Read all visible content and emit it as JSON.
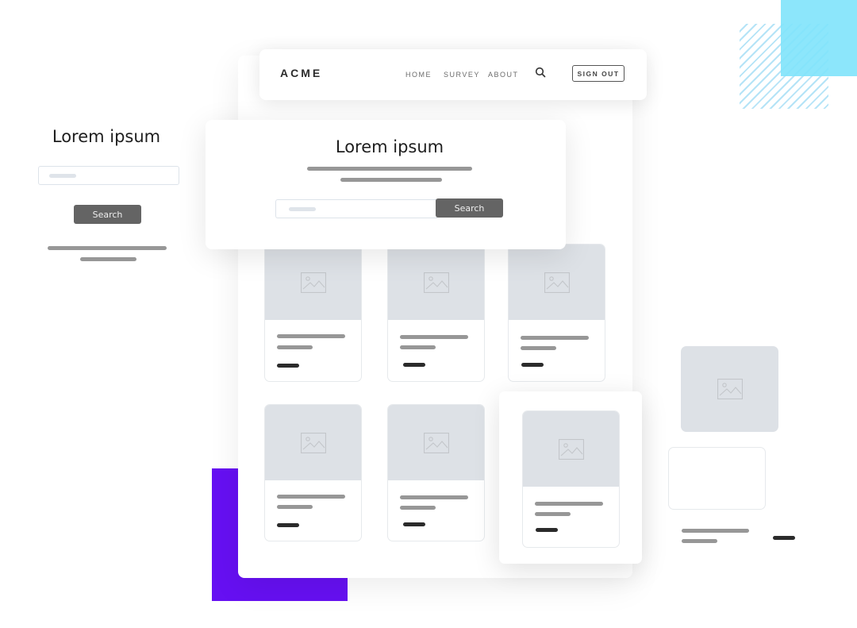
{
  "navbar": {
    "logo": "ACME",
    "links": [
      {
        "label": "HOME"
      },
      {
        "label": "SURVEY"
      },
      {
        "label": "ABOUT"
      }
    ],
    "search_icon": "search-icon",
    "signout_label": "SIGN OUT"
  },
  "hero": {
    "title": "Lorem ipsum",
    "search_button": "Search",
    "search_placeholder": ""
  },
  "side_panel": {
    "title": "Lorem ipsum",
    "search_button": "Search",
    "search_placeholder": ""
  },
  "product_cards": [
    {
      "image_icon": "image-icon"
    },
    {
      "image_icon": "image-icon"
    },
    {
      "image_icon": "image-icon"
    },
    {
      "image_icon": "image-icon"
    },
    {
      "image_icon": "image-icon"
    },
    {
      "image_icon": "image-icon"
    }
  ],
  "colors": {
    "accent_purple": "#6610f2",
    "accent_cyan": "#7fe3fb",
    "button_gray": "#646464",
    "placeholder_gray": "#dde1e6"
  }
}
